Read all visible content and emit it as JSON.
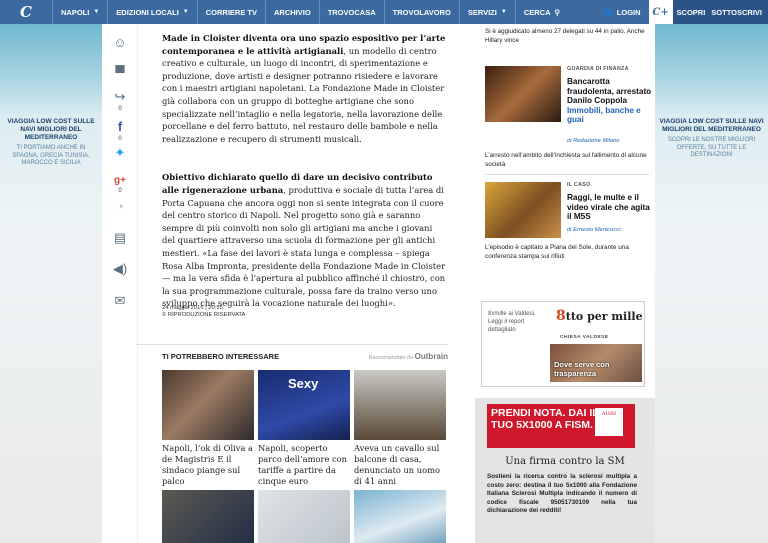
{
  "nav": {
    "logo": "C",
    "items": [
      "NAPOLI",
      "EDIZIONI LOCALI",
      "CORRIERE TV",
      "ARCHIVIO",
      "TROVOCASA",
      "TROVOLAVORO",
      "SERVIZI",
      "CERCA"
    ],
    "login": "LOGIN",
    "cplus": "C+",
    "scopri": "SCOPRI",
    "sottoscrivi": "SOTTOSCRIVI",
    "colors": {
      "bar": "#3a6aa0",
      "dark": "#2a5487"
    }
  },
  "side_ad_left": {
    "headline": "VIAGGIA LOW COST SULLE NAVI MIGLIORI DEL MEDITERRANEO",
    "body": "TI PORTIAMO ANCHE IN SPAGNA, GRECIA TUNISIA, MAROCCO E SICILIA"
  },
  "side_ad_right": {
    "headline": "VIAGGIA LOW COST SULLE NAVI MIGLIORI DEL MEDITERRANEO",
    "body": "SCOPRI LE NOSTRE MIGLIORI OFFERTE, SU TUTTE LE DESTINAZIONI"
  },
  "share": {
    "icons": [
      "smile-icon",
      "comment-icon",
      "reshare-icon",
      "facebook-icon",
      "twitter-icon",
      "googleplus-icon",
      "clock-icon",
      "print-icon",
      "audio-icon",
      "email-icon"
    ],
    "counts": {
      "reshare": "0",
      "facebook": "0",
      "googleplus": "0",
      "clock": "0"
    }
  },
  "article": {
    "p1_bold": "Made in Cloister diventa ora uno spazio espositivo per l’arte contemporanea e le attività artigianali",
    "p1_rest": ", un modello di centro creativo e culturale, un luogo di incontri, di sperimentazione e produzione, dove artisti e designer potranno risiedere e lavorare con i maestri artigiani napoletani. La Fondazione Made in Cloister già collabora con un gruppo di botteghe artigiane che sono specializzate nell’intaglio e nella legatoria, nella lavorazione delle porcellane e del ferro battuto, nel restauro delle bambole e nella realizzazione e recupero di strumenti musicali.",
    "p2_bold": "Obiettivo dichiarato quello di dare un decisivo contributo alle rigenerazione urbana",
    "p2_rest": ", produttiva e sociale di tutta l’area di Porta Capuana che ancora oggi non si sente integrata con il cuore del centro storico di Napoli. Nel progetto sono già e saranno sempre di più coinvolti non solo gli artigiani ma anche i giovani del quartiere attraverso una scuola di formazione per gli antichi mestieri. «La fase dei lavori è stata lunga e complessa – spiega Rosa Alba Impronta, presidente della Fondazione Made in Cloister — ma la vera sfida è l’apertura al pubblico affinché il chiostro, con la sua programmazione culturale, possa fare da traino verso uno sviluppo che seguirà la vocazione naturale dei luoghi».",
    "date": "24 maggio 2016 | 20:55",
    "rights": "© RIPRODUZIONE RISERVATA"
  },
  "recommended": {
    "title": "TI POTREBBERO INTERESSARE",
    "by": "Raccomandato da",
    "brand": "Outbrain",
    "cards": [
      {
        "caption": "Napoli, l’ok di Oliva a de Magistris E il sindaco piange sul palco"
      },
      {
        "caption": "Napoli, scoperto parco dell’amore con tariffe a partire da cinque euro"
      },
      {
        "caption": "Aveva un cavallo sul balcone di casa, denunciato un uomo di 41 anni"
      }
    ],
    "img2_text": "Sexy"
  },
  "right": {
    "top_text": "Si è aggiudicato almeno 27 delegati su 44 in palio. Anche Hillary vince",
    "stories": [
      {
        "kicker": "GUARDIA DI FINANZA",
        "headline": "Bancarotta fraudolenta, arrestato Danilo Coppola",
        "headline_link": "Immobili, banche e guai",
        "byline": "di Redazione Milano",
        "summary": "L’arresto nell’ambito dell’inchiesta sul fallimento di alcune società"
      },
      {
        "kicker": "IL CASO",
        "headline": "Raggi, le multe e il video virale che agita il M5S",
        "byline": "di Ernesto Menicucci",
        "summary": "L’episodio è capitato a Piana del Sole, durante una conferenza stampa sui rifiuti"
      }
    ],
    "ad_8x1000": {
      "left_text": "8xmille ai Valdesi. Leggi il report dettagliato",
      "brand_a": "8",
      "brand_b": "tto per mille",
      "sub": "CHIESA VALDESE",
      "overlay": "Dove serve con trasparenza"
    },
    "ad_aism": {
      "banner": "PRENDI NOTA. DAI IL TUO 5X1000 A FISM.",
      "logo": "AISM",
      "heading": "Una firma contro la SM",
      "body": "Sostieni la ricerca contro la sclerosi multipla a costo zero: destina il tuo 5x1000 alla Fondazione Italiana Sclerosi Multipla indicando il numero di codice fiscale 95051730109 nella tua dichiarazione dei redditi!"
    }
  }
}
